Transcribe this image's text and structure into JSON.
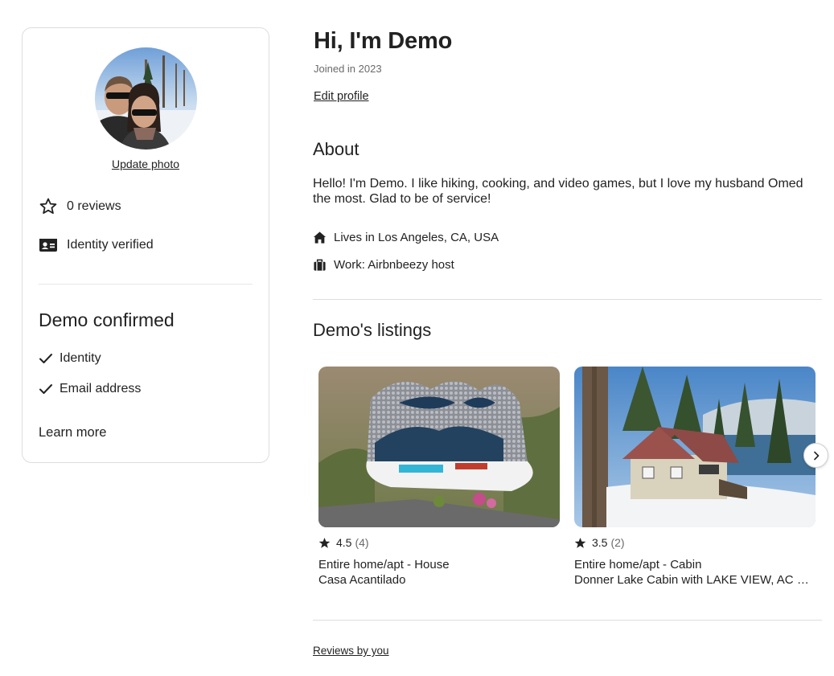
{
  "profile_card": {
    "update_photo_label": "Update photo",
    "reviews_label": "0 reviews",
    "identity_label": "Identity verified",
    "confirmed_title": "Demo confirmed",
    "confirmed_items": [
      "Identity",
      "Email address"
    ],
    "learn_more_label": "Learn more"
  },
  "header": {
    "greeting": "Hi, I'm Demo",
    "joined": "Joined in 2023",
    "edit_profile_label": "Edit profile"
  },
  "about": {
    "title": "About",
    "text": "Hello! I'm Demo. I like hiking, cooking, and video games, but I love my husband Omed the most. Glad to be of service!",
    "lives": "Lives in Los Angeles, CA, USA",
    "work": "Work: Airbnbeezy host"
  },
  "listings": {
    "title": "Demo's listings",
    "items": [
      {
        "rating": "4.5",
        "count": "(4)",
        "type": "Entire home/apt - House",
        "name": "Casa Acantilado"
      },
      {
        "rating": "3.5",
        "count": "(2)",
        "type": "Entire home/apt - Cabin",
        "name": "Donner Lake Cabin with LAKE VIEW, AC and more"
      }
    ]
  },
  "footer": {
    "reviews_by_you_label": "Reviews by you"
  },
  "icons": {
    "star": "star-outline-icon",
    "identity": "id-card-icon",
    "check": "checkmark-icon",
    "home": "home-icon",
    "work": "briefcase-icon",
    "rating_star": "star-filled-icon",
    "next": "chevron-right-icon"
  }
}
